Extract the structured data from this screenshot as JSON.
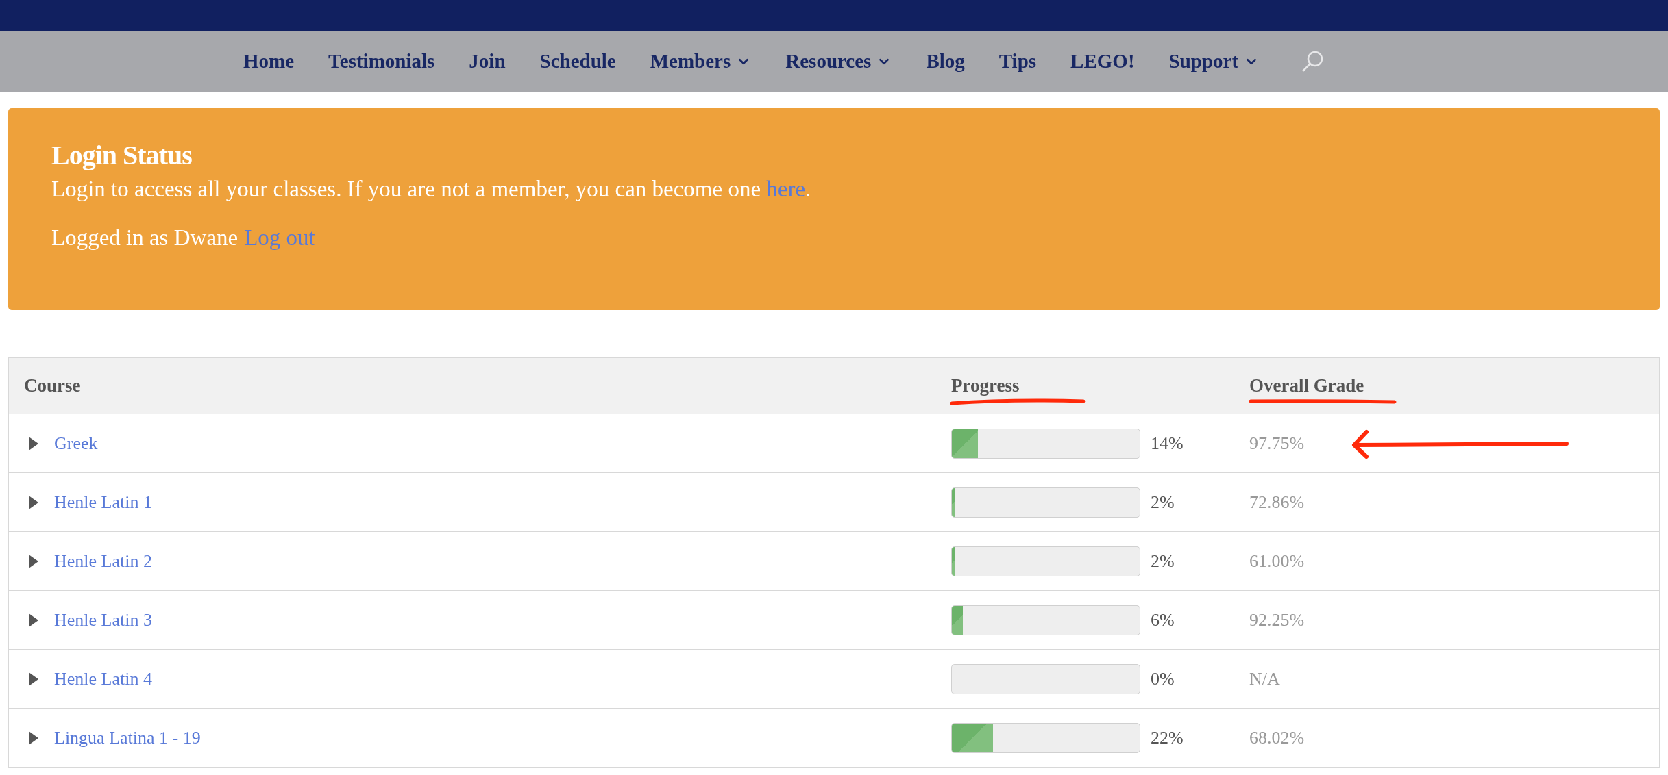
{
  "nav": [
    {
      "label": "Home",
      "dropdown": false
    },
    {
      "label": "Testimonials",
      "dropdown": false
    },
    {
      "label": "Join",
      "dropdown": false
    },
    {
      "label": "Schedule",
      "dropdown": false
    },
    {
      "label": "Members",
      "dropdown": true
    },
    {
      "label": "Resources",
      "dropdown": true
    },
    {
      "label": "Blog",
      "dropdown": false
    },
    {
      "label": "Tips",
      "dropdown": false
    },
    {
      "label": "LEGO!",
      "dropdown": false
    },
    {
      "label": "Support",
      "dropdown": true
    }
  ],
  "login_status": {
    "title": "Login Status",
    "message": "Login to access all your classes. If you are not a member, you can become one",
    "link": "here",
    "after_link": ".",
    "logged_in": "Logged in as Dwane",
    "logout": "Log out"
  },
  "table": {
    "columns": [
      "Course",
      "Progress",
      "Overall Grade"
    ],
    "rows": [
      {
        "course": "Greek",
        "level": 0.14,
        "percent": "14%",
        "grade": "97.75%"
      },
      {
        "course": "Henle Latin 1",
        "level": 0.02,
        "percent": "2%",
        "grade": "72.86%"
      },
      {
        "course": "Henle Latin 2",
        "level": 0.02,
        "percent": "2%",
        "grade": "61.00%"
      },
      {
        "course": "Henle Latin 3",
        "level": 0.06,
        "percent": "6%",
        "grade": "92.25%"
      },
      {
        "course": "Henle Latin 4",
        "level": 0,
        "percent": "0%",
        "grade": "N/A"
      },
      {
        "course": "Lingua Latina 1 - 19",
        "level": 0.22,
        "percent": "22%",
        "grade": "68.02%"
      }
    ]
  }
}
